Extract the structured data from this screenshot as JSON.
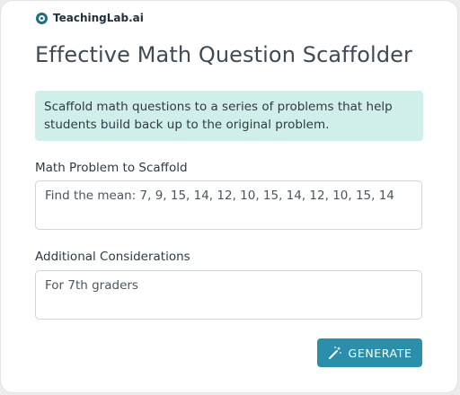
{
  "brand": {
    "name": "TeachingLab.ai"
  },
  "page": {
    "title": "Effective Math Question Scaffolder"
  },
  "info": {
    "text": "Scaffold math questions to a series of problems that help students build back up to the original problem."
  },
  "fields": [
    {
      "label": "Math Problem to Scaffold",
      "value": "Find the mean: 7, 9, 15, 14, 12, 10, 15, 14, 12, 10, 15, 14"
    },
    {
      "label": "Additional Considerations",
      "value": "For 7th graders"
    }
  ],
  "actions": {
    "generate_label": "GENERATE",
    "generate_icon": "magic-wand-icon"
  },
  "colors": {
    "accent": "#2b8fab",
    "info_bg": "#d1efea",
    "brand": "#1f6f84"
  }
}
